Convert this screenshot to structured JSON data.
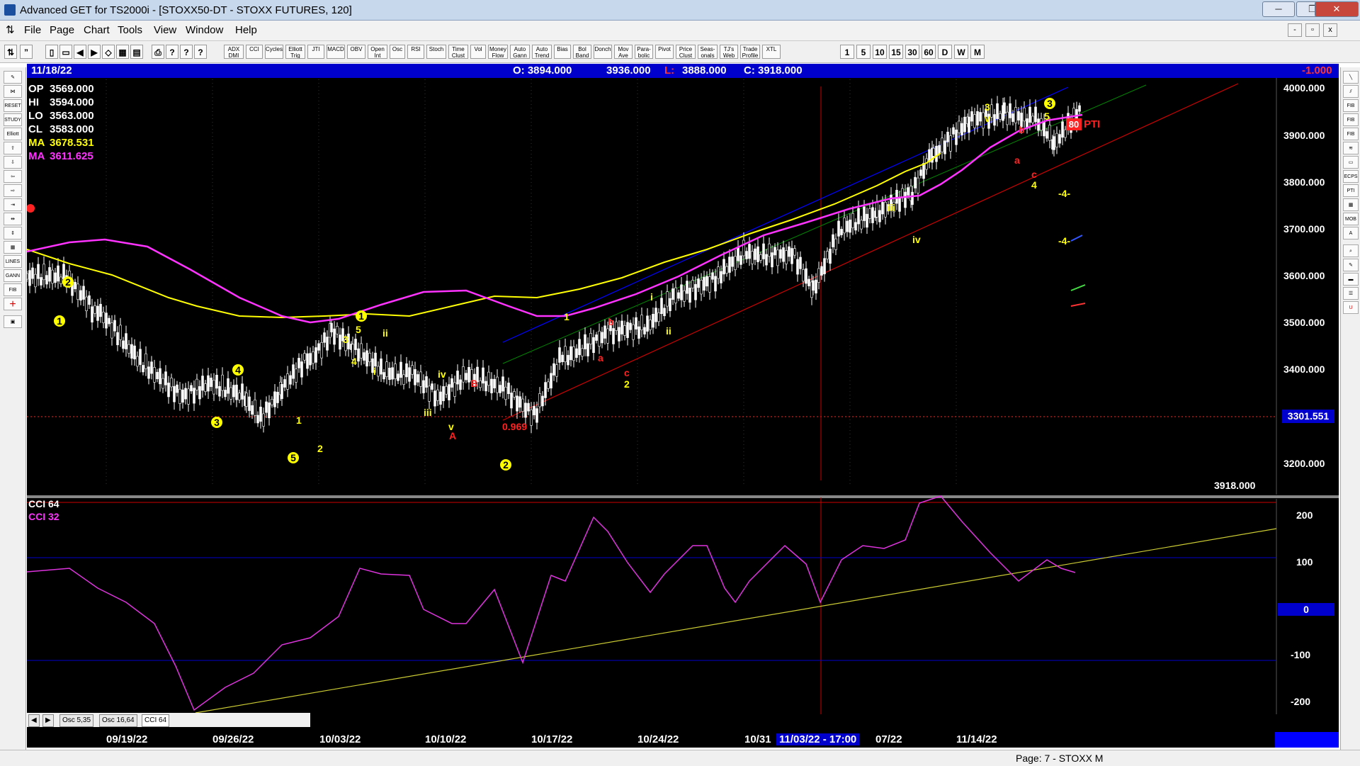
{
  "window": {
    "title": "Advanced GET for TS2000i - [STOXX50-DT - STOXX FUTURES, 120]"
  },
  "menu": [
    "File",
    "Page",
    "Chart",
    "Tools",
    "View",
    "Window",
    "Help"
  ],
  "toolbar_buttons": [
    "ADX DMI",
    "CCI",
    "Cycles",
    "Elliott Trig",
    "JTI",
    "MACD",
    "OBV",
    "Open Int",
    "Osc",
    "RSI",
    "Stoch",
    "Time Clust",
    "Vol",
    "Money Flow",
    "Auto Gann",
    "Auto Trend",
    "Bias",
    "Bol Band",
    "Donch",
    "Mov Ave",
    "Para- bolic",
    "Pivot",
    "Price Clust",
    "Seas- onals",
    "TJ's Web",
    "Trade Profile",
    "XTL"
  ],
  "interval_buttons": [
    "1",
    "5",
    "10",
    "15",
    "30",
    "60",
    "D",
    "W",
    "M"
  ],
  "left_tool_labels": [
    "RESET",
    "STUDY",
    "Elliott",
    "LINES",
    "GANN",
    "FIB"
  ],
  "right_tool_labels": [
    "FIB RET",
    "FIB EXT",
    "FIB TIME",
    "ECPS",
    "PTI",
    "MOB"
  ],
  "info_bar": {
    "date": "11/18/22",
    "open": "O: 3894.000",
    "high": "3936.000",
    "low_label": "L:",
    "low": "3888.000",
    "close": "C: 3918.000",
    "change": "-1.000"
  },
  "ohlc_panel": [
    {
      "label": "OP",
      "value": "3569.000",
      "color": "#ffffff"
    },
    {
      "label": "HI",
      "value": "3594.000",
      "color": "#ffffff"
    },
    {
      "label": "LO",
      "value": "3563.000",
      "color": "#ffffff"
    },
    {
      "label": "CL",
      "value": "3583.000",
      "color": "#ffffff"
    },
    {
      "label": "MA",
      "value": "3678.531",
      "color": "#ffff00"
    },
    {
      "label": "MA",
      "value": "3611.625",
      "color": "#ff33ff"
    }
  ],
  "price_axis": [
    "4000.000",
    "3900.000",
    "3800.000",
    "3700.000",
    "3600.000",
    "3500.000",
    "3400.000",
    "3300.000",
    "3200.000"
  ],
  "price_marker": "3301.551",
  "last_price": "3918.000",
  "pti_label": "80",
  "pti_text": "PTI",
  "target_labels": [
    "-4-",
    "-4-"
  ],
  "partial_label": "0.969",
  "cci_panel": {
    "line1": "CCI 64",
    "line2": "CCI  32",
    "axis": [
      "200",
      "100",
      "0",
      "-100",
      "-200"
    ]
  },
  "osc_tabs": [
    "Osc 5,35",
    "Osc 16,64",
    "CCI 64"
  ],
  "date_axis": [
    "09/19/22",
    "09/26/22",
    "10/03/22",
    "10/10/22",
    "10/17/22",
    "10/24/22",
    "10/31",
    "11/03/22 - 17:00",
    "07/22",
    "11/14/22"
  ],
  "status": "Page: 7 - STOXX M",
  "wave_labels": [
    {
      "t": "2",
      "c": "#ffff00",
      "circle": true
    },
    {
      "t": "1",
      "c": "#ffff00",
      "circle": true
    },
    {
      "t": "3",
      "c": "#ffff00",
      "circle": true
    },
    {
      "t": "4",
      "c": "#ffff00",
      "circle": true
    },
    {
      "t": "5",
      "c": "#ffff00",
      "circle": true
    },
    {
      "t": "1",
      "c": "#ffff00",
      "circle": false
    },
    {
      "t": "2",
      "c": "#ffff00",
      "circle": false
    },
    {
      "t": "1",
      "c": "#ffff00",
      "circle": true
    },
    {
      "t": "5",
      "c": "#ffff00",
      "circle": false
    },
    {
      "t": "3",
      "c": "#ffff00",
      "circle": false
    },
    {
      "t": "4",
      "c": "#ffff00",
      "circle": false
    },
    {
      "t": "ii",
      "c": "#ffff00",
      "circle": false
    },
    {
      "t": "i",
      "c": "#ffff00",
      "circle": false
    },
    {
      "t": "iv",
      "c": "#ffff00",
      "circle": false
    },
    {
      "t": "iii",
      "c": "#ffff00",
      "circle": false
    },
    {
      "t": "v",
      "c": "#ffff00",
      "circle": false
    },
    {
      "t": "A",
      "c": "#ff2222",
      "circle": false
    },
    {
      "t": "B",
      "c": "#ff2222",
      "circle": false
    },
    {
      "t": "2",
      "c": "#ffff00",
      "circle": true
    },
    {
      "t": "1",
      "c": "#ffff00",
      "circle": false
    },
    {
      "t": "b",
      "c": "#ff2222",
      "circle": false
    },
    {
      "t": "a",
      "c": "#ff2222",
      "circle": false
    },
    {
      "t": "c",
      "c": "#ff2222",
      "circle": false
    },
    {
      "t": "2",
      "c": "#ffff00",
      "circle": false
    },
    {
      "t": "i",
      "c": "#ffff00",
      "circle": false
    },
    {
      "t": "ii",
      "c": "#ffff00",
      "circle": false
    },
    {
      "t": "iii",
      "c": "#ffff00",
      "circle": false
    },
    {
      "t": "iv",
      "c": "#ffff00",
      "circle": false
    },
    {
      "t": "3",
      "c": "#ffff00",
      "circle": false
    },
    {
      "t": "v",
      "c": "#ffff00",
      "circle": false
    },
    {
      "t": "b",
      "c": "#ff2222",
      "circle": false
    },
    {
      "t": "a",
      "c": "#ff2222",
      "circle": false
    },
    {
      "t": "c",
      "c": "#ff2222",
      "circle": false
    },
    {
      "t": "4",
      "c": "#ffff00",
      "circle": false
    },
    {
      "t": "3",
      "c": "#ffff00",
      "circle": true
    },
    {
      "t": "5",
      "c": "#ffff00",
      "circle": false
    }
  ]
}
